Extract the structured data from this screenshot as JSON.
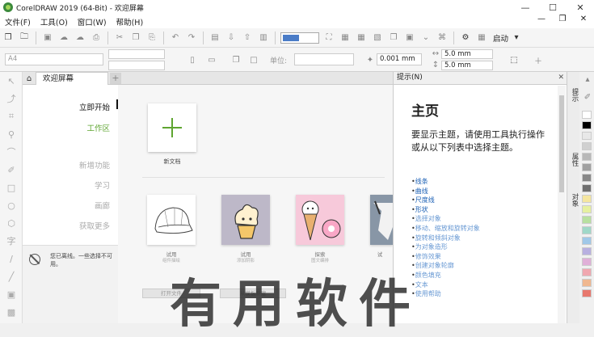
{
  "window": {
    "title": "CorelDRAW 2019 (64-Bit) - 欢迎屏幕",
    "minimize": "—",
    "maximize": "☐",
    "close": "✕"
  },
  "menu": {
    "items": [
      "文件(F)",
      "工具(O)",
      "窗口(W)",
      "帮助(H)"
    ],
    "right_icons": [
      "—",
      "❐",
      "✕"
    ]
  },
  "toolbar": {
    "start_label": "启动"
  },
  "propbar": {
    "page_size": "A4",
    "units_label": "单位:",
    "nudge_value": "0.001 mm",
    "dup_x": "5.0 mm",
    "dup_y": "5.0 mm"
  },
  "tabs": {
    "welcome_tab": "欢迎屏幕",
    "add_tab": "+"
  },
  "welcome_nav": {
    "items": [
      "立即开始",
      "工作区",
      "新增功能",
      "学习",
      "画廊",
      "获取更多"
    ]
  },
  "offline_notice": "您已离线。一些选择不可用。",
  "new_doc_label": "新文档",
  "thumbnails": [
    {
      "label": "试用",
      "sub": "组件描绘"
    },
    {
      "label": "试用",
      "sub": "添加阴影"
    },
    {
      "label": "探索",
      "sub": "图文编排"
    },
    {
      "label": "试",
      "sub": ""
    }
  ],
  "buttons": {
    "open_file": "打开文件",
    "from_template": "从模板新建"
  },
  "docker": {
    "header": "提示(N)",
    "close": "✕",
    "title": "主页",
    "description": "要显示主题，请使用工具执行操作或从以下列表中选择主题。",
    "topics": [
      "线条",
      "曲线",
      "尺度线",
      "形状",
      "选择对象",
      "移动、缩放和旋转对象",
      "旋转和倾斜对象",
      "为对象造形",
      "修饰效果",
      "创建对象轮廓",
      "颜色填充",
      "文本",
      "使用帮助"
    ]
  },
  "side_tabs": [
    "提示",
    "属性",
    "对象"
  ],
  "palette_colors": [
    "#ffffff",
    "#000000",
    "#e8e8e8",
    "#d0d0d0",
    "#b8b8b8",
    "#a0a0a0",
    "#888888",
    "#707070",
    "#f5e6a0",
    "#e6f0a0",
    "#b8e0a0",
    "#a0d8c8",
    "#a0c8e8",
    "#b8b0e0",
    "#e0b0d8",
    "#f0a8b0",
    "#f0b890",
    "#e8786e"
  ],
  "watermark": "有用软件"
}
